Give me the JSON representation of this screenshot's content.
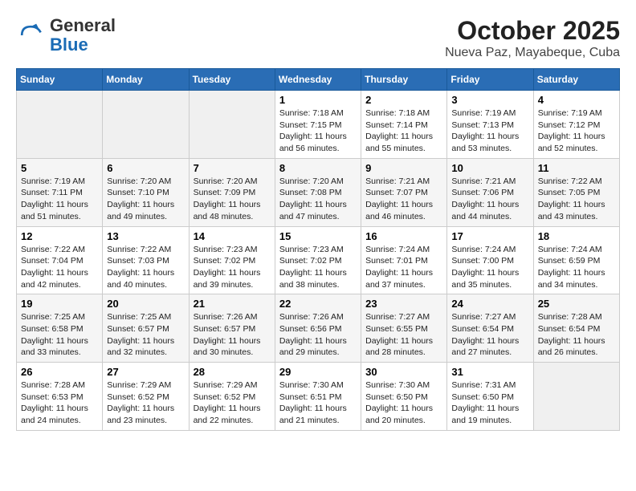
{
  "logo": {
    "general": "General",
    "blue": "Blue"
  },
  "title": "October 2025",
  "subtitle": "Nueva Paz, Mayabeque, Cuba",
  "weekdays": [
    "Sunday",
    "Monday",
    "Tuesday",
    "Wednesday",
    "Thursday",
    "Friday",
    "Saturday"
  ],
  "weeks": [
    [
      {
        "day": "",
        "info": ""
      },
      {
        "day": "",
        "info": ""
      },
      {
        "day": "",
        "info": ""
      },
      {
        "day": "1",
        "info": "Sunrise: 7:18 AM\nSunset: 7:15 PM\nDaylight: 11 hours and 56 minutes."
      },
      {
        "day": "2",
        "info": "Sunrise: 7:18 AM\nSunset: 7:14 PM\nDaylight: 11 hours and 55 minutes."
      },
      {
        "day": "3",
        "info": "Sunrise: 7:19 AM\nSunset: 7:13 PM\nDaylight: 11 hours and 53 minutes."
      },
      {
        "day": "4",
        "info": "Sunrise: 7:19 AM\nSunset: 7:12 PM\nDaylight: 11 hours and 52 minutes."
      }
    ],
    [
      {
        "day": "5",
        "info": "Sunrise: 7:19 AM\nSunset: 7:11 PM\nDaylight: 11 hours and 51 minutes."
      },
      {
        "day": "6",
        "info": "Sunrise: 7:20 AM\nSunset: 7:10 PM\nDaylight: 11 hours and 49 minutes."
      },
      {
        "day": "7",
        "info": "Sunrise: 7:20 AM\nSunset: 7:09 PM\nDaylight: 11 hours and 48 minutes."
      },
      {
        "day": "8",
        "info": "Sunrise: 7:20 AM\nSunset: 7:08 PM\nDaylight: 11 hours and 47 minutes."
      },
      {
        "day": "9",
        "info": "Sunrise: 7:21 AM\nSunset: 7:07 PM\nDaylight: 11 hours and 46 minutes."
      },
      {
        "day": "10",
        "info": "Sunrise: 7:21 AM\nSunset: 7:06 PM\nDaylight: 11 hours and 44 minutes."
      },
      {
        "day": "11",
        "info": "Sunrise: 7:22 AM\nSunset: 7:05 PM\nDaylight: 11 hours and 43 minutes."
      }
    ],
    [
      {
        "day": "12",
        "info": "Sunrise: 7:22 AM\nSunset: 7:04 PM\nDaylight: 11 hours and 42 minutes."
      },
      {
        "day": "13",
        "info": "Sunrise: 7:22 AM\nSunset: 7:03 PM\nDaylight: 11 hours and 40 minutes."
      },
      {
        "day": "14",
        "info": "Sunrise: 7:23 AM\nSunset: 7:02 PM\nDaylight: 11 hours and 39 minutes."
      },
      {
        "day": "15",
        "info": "Sunrise: 7:23 AM\nSunset: 7:02 PM\nDaylight: 11 hours and 38 minutes."
      },
      {
        "day": "16",
        "info": "Sunrise: 7:24 AM\nSunset: 7:01 PM\nDaylight: 11 hours and 37 minutes."
      },
      {
        "day": "17",
        "info": "Sunrise: 7:24 AM\nSunset: 7:00 PM\nDaylight: 11 hours and 35 minutes."
      },
      {
        "day": "18",
        "info": "Sunrise: 7:24 AM\nSunset: 6:59 PM\nDaylight: 11 hours and 34 minutes."
      }
    ],
    [
      {
        "day": "19",
        "info": "Sunrise: 7:25 AM\nSunset: 6:58 PM\nDaylight: 11 hours and 33 minutes."
      },
      {
        "day": "20",
        "info": "Sunrise: 7:25 AM\nSunset: 6:57 PM\nDaylight: 11 hours and 32 minutes."
      },
      {
        "day": "21",
        "info": "Sunrise: 7:26 AM\nSunset: 6:57 PM\nDaylight: 11 hours and 30 minutes."
      },
      {
        "day": "22",
        "info": "Sunrise: 7:26 AM\nSunset: 6:56 PM\nDaylight: 11 hours and 29 minutes."
      },
      {
        "day": "23",
        "info": "Sunrise: 7:27 AM\nSunset: 6:55 PM\nDaylight: 11 hours and 28 minutes."
      },
      {
        "day": "24",
        "info": "Sunrise: 7:27 AM\nSunset: 6:54 PM\nDaylight: 11 hours and 27 minutes."
      },
      {
        "day": "25",
        "info": "Sunrise: 7:28 AM\nSunset: 6:54 PM\nDaylight: 11 hours and 26 minutes."
      }
    ],
    [
      {
        "day": "26",
        "info": "Sunrise: 7:28 AM\nSunset: 6:53 PM\nDaylight: 11 hours and 24 minutes."
      },
      {
        "day": "27",
        "info": "Sunrise: 7:29 AM\nSunset: 6:52 PM\nDaylight: 11 hours and 23 minutes."
      },
      {
        "day": "28",
        "info": "Sunrise: 7:29 AM\nSunset: 6:52 PM\nDaylight: 11 hours and 22 minutes."
      },
      {
        "day": "29",
        "info": "Sunrise: 7:30 AM\nSunset: 6:51 PM\nDaylight: 11 hours and 21 minutes."
      },
      {
        "day": "30",
        "info": "Sunrise: 7:30 AM\nSunset: 6:50 PM\nDaylight: 11 hours and 20 minutes."
      },
      {
        "day": "31",
        "info": "Sunrise: 7:31 AM\nSunset: 6:50 PM\nDaylight: 11 hours and 19 minutes."
      },
      {
        "day": "",
        "info": ""
      }
    ]
  ]
}
